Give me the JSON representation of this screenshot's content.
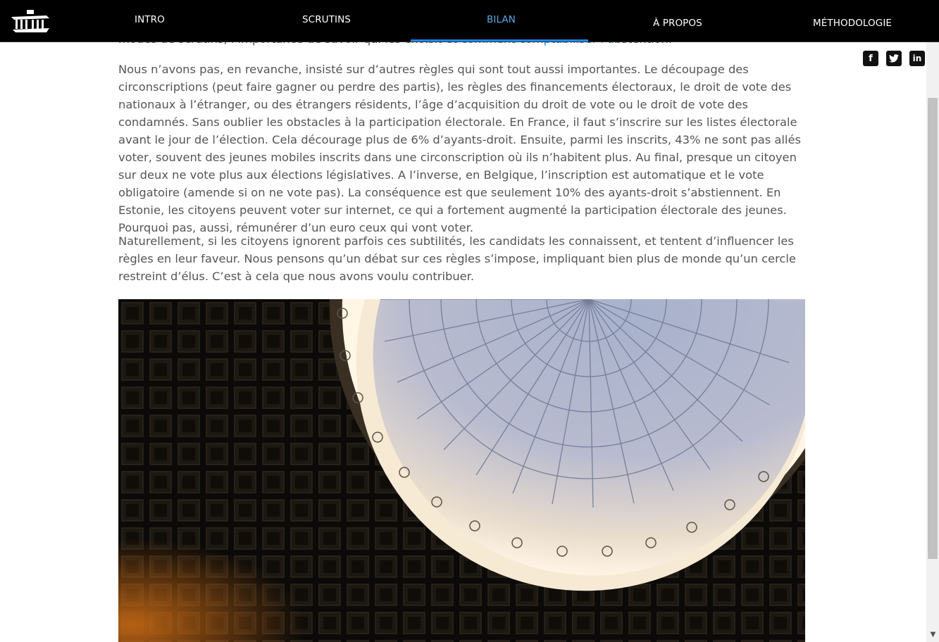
{
  "nav": {
    "items": [
      "INTRO",
      "SCRUTINS",
      "BILAN",
      "À PROPOS",
      "MÉTHODOLOGIE"
    ],
    "active": "BILAN"
  },
  "social": {
    "facebook_icon": "f",
    "twitter_icon": "t",
    "linkedin_icon": "in"
  },
  "article": {
    "p0_before": "modes de scrutins, l’importance de savoir qui les choi",
    "p0_link": "sit et comment comptabiliser l’a",
    "p0_after": "bstention.",
    "p1": "Nous n’avons pas, en revanche, insisté sur d’autres règles qui sont tout aussi importantes. Le découpage des circonscriptions (peut faire gagner ou perdre des partis), les règles des financements électoraux, le droit de vote des nationaux à l’étranger, ou des étrangers résidents, l’âge d’acquisition du droit de vote ou le droit de vote des condamnés. Sans oublier les obstacles à la participation électorale. En France, il faut s’inscrire sur les listes électorale avant le jour de l’élection. Cela décourage plus de 6% d’ayants-droit. Ensuite, parmi les inscrits, 43% ne sont pas allés voter, souvent des jeunes mobiles inscrits dans une circonscription où ils n’habitent plus. Au final, presque un citoyen sur deux ne vote plus aux élections législatives. A l’inverse, en Belgique, l’inscription est automatique et le vote obligatoire (amende si on ne vote pas). La conséquence est que seulement 10% des ayants-droit s’abstiennent. En Estonie, les citoyens peuvent voter sur internet, ce qui a fortement augmenté la participation électorale des jeunes. Pourquoi pas, aussi, rémunérer d’un euro ceux qui vont voter.",
    "p2": "Naturellement, si les citoyens ignorent parfois ces subtilités, les candidats les connaissent, et tentent d’influencer les règles en leur faveur. Nous pensons qu’un débat sur ces règles s’impose, impliquant bien plus de monde qu’un cercle restreint d’élus. C’est à cela que nous avons voulu contribuer."
  },
  "scrollbar": {
    "down_arrow": "▼"
  }
}
